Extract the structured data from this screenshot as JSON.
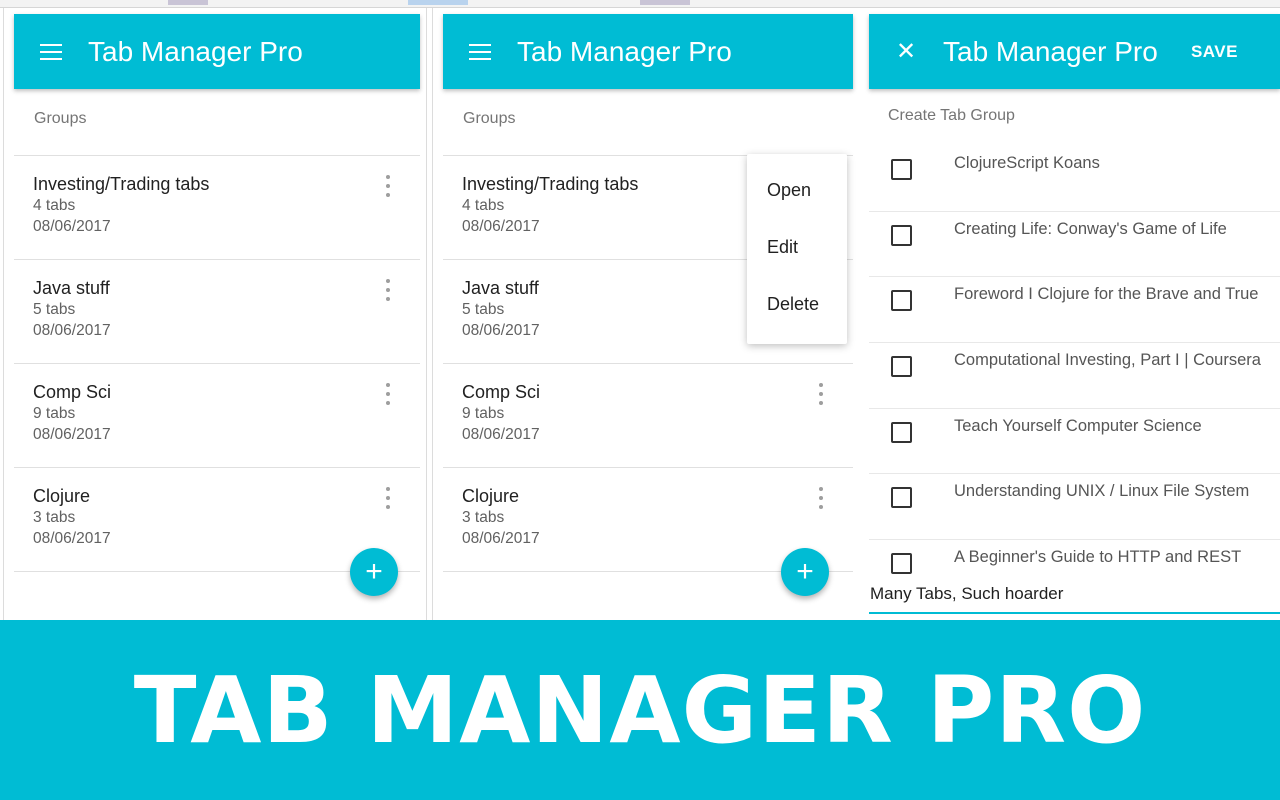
{
  "accent_color": "#00bcd4",
  "app": {
    "title": "Tab Manager Pro"
  },
  "panel1": {
    "menu_icon": "hamburger-icon",
    "subheader": "Groups",
    "groups": [
      {
        "name": "Investing/Trading tabs",
        "count": "4 tabs",
        "date": "08/06/2017"
      },
      {
        "name": "Java stuff",
        "count": "5 tabs",
        "date": "08/06/2017"
      },
      {
        "name": "Comp Sci",
        "count": "9 tabs",
        "date": "08/06/2017"
      },
      {
        "name": "Clojure",
        "count": "3 tabs",
        "date": "08/06/2017"
      }
    ],
    "fab_icon": "plus-icon"
  },
  "panel2": {
    "subheader": "Groups",
    "groups": [
      {
        "name": "Investing/Trading tabs",
        "count": "4 tabs",
        "date": "08/06/2017"
      },
      {
        "name": "Java stuff",
        "count": "5 tabs",
        "date": "08/06/2017"
      },
      {
        "name": "Comp Sci",
        "count": "9 tabs",
        "date": "08/06/2017"
      },
      {
        "name": "Clojure",
        "count": "3 tabs",
        "date": "08/06/2017"
      }
    ],
    "context_menu": {
      "open": "Open",
      "edit": "Edit",
      "delete": "Delete"
    }
  },
  "panel3": {
    "close_icon": "close-icon",
    "save_label": "SAVE",
    "subheader": "Create Tab Group",
    "tabs": [
      {
        "title": "ClojureScript Koans"
      },
      {
        "title": "Creating Life: Conway's Game of Life"
      },
      {
        "title": "Foreword I Clojure for the Brave and True"
      },
      {
        "title": "Computational Investing, Part I | Coursera"
      },
      {
        "title": "Teach Yourself Computer Science"
      },
      {
        "title": "Understanding UNIX / Linux File System"
      },
      {
        "title": "A Beginner's Guide to HTTP and REST"
      }
    ],
    "group_name_value": "Many Tabs, Such hoarder"
  },
  "banner": {
    "text": "TAB MANAGER PRO"
  }
}
